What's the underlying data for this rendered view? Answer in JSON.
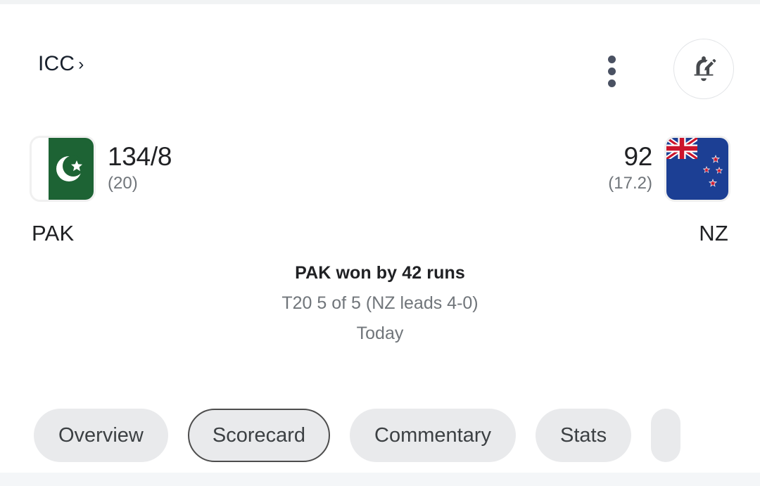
{
  "header": {
    "breadcrumb_label": "ICC",
    "breadcrumb_chevron": "›",
    "overflow_icon": "more-vertical-icon",
    "notify_icon": "bell-edit-icon"
  },
  "match": {
    "home": {
      "code": "PAK",
      "flag_icon": "pakistan-flag-icon",
      "score": "134/8",
      "overs": "(20)"
    },
    "away": {
      "code": "NZ",
      "flag_icon": "new-zealand-flag-icon",
      "score": "92",
      "overs": "(17.2)"
    },
    "result_headline": "PAK won by 42 runs",
    "series_info": "T20 5 of 5 (NZ leads 4-0)",
    "date_label": "Today"
  },
  "tabs": [
    {
      "label": "Overview",
      "selected": false
    },
    {
      "label": "Scorecard",
      "selected": true
    },
    {
      "label": "Commentary",
      "selected": false
    },
    {
      "label": "Stats",
      "selected": false
    },
    {
      "label": "",
      "selected": false
    }
  ],
  "colors": {
    "page_background": "#f1f3f4",
    "card_background": "#ffffff",
    "primary_text": "#202124",
    "secondary_text": "#70757a",
    "pill_background": "#e9eaec",
    "pill_selected_border": "#4d4d4d",
    "overflow_dots": "#4a5162",
    "pakistan_green": "#1d6334",
    "newzealand_blue": "#1c3f94",
    "newzealand_red": "#cc142b"
  }
}
